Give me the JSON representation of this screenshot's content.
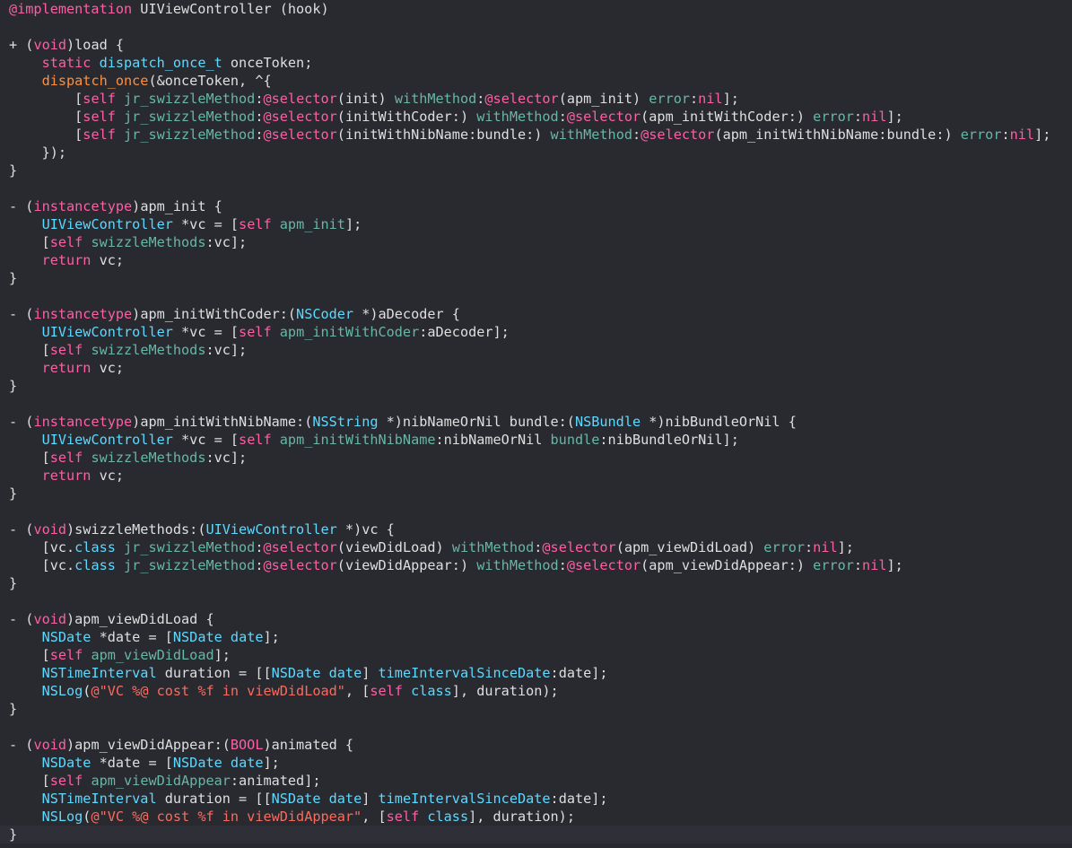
{
  "editor": {
    "theme_colors": {
      "background": "#292a30",
      "plain_text": "#dfdfe0",
      "keyword": "#fc5fa3",
      "system_type": "#5dd8ff",
      "project_method": "#67b7a4",
      "string": "#fc6a5d",
      "macro": "#fd8f3f",
      "current_line": "#2f3037"
    },
    "cursor_line": 47,
    "lines": [
      [
        [
          "@implementation",
          "kw"
        ],
        [
          " UIViewController (hook)",
          "txt"
        ]
      ],
      [],
      [
        [
          "+ (",
          "txt"
        ],
        [
          "void",
          "kb"
        ],
        [
          ")load {",
          "txt"
        ]
      ],
      [
        [
          "    ",
          "txt"
        ],
        [
          "static",
          "kw"
        ],
        [
          " ",
          "txt"
        ],
        [
          "dispatch_once_t",
          "sys"
        ],
        [
          " onceToken;",
          "txt"
        ]
      ],
      [
        [
          "    ",
          "txt"
        ],
        [
          "dispatch_once",
          "mac"
        ],
        [
          "(&onceToken, ^{",
          "txt"
        ]
      ],
      [
        [
          "        [",
          "txt"
        ],
        [
          "self",
          "kw"
        ],
        [
          " ",
          "txt"
        ],
        [
          "jr_swizzleMethod",
          "pm"
        ],
        [
          ":",
          "txt"
        ],
        [
          "@selector",
          "sel"
        ],
        [
          "(init) ",
          "txt"
        ],
        [
          "withMethod",
          "pm"
        ],
        [
          ":",
          "txt"
        ],
        [
          "@selector",
          "sel"
        ],
        [
          "(apm_init) ",
          "txt"
        ],
        [
          "error",
          "pm"
        ],
        [
          ":",
          "txt"
        ],
        [
          "nil",
          "kb"
        ],
        [
          "];",
          "txt"
        ]
      ],
      [
        [
          "        [",
          "txt"
        ],
        [
          "self",
          "kw"
        ],
        [
          " ",
          "txt"
        ],
        [
          "jr_swizzleMethod",
          "pm"
        ],
        [
          ":",
          "txt"
        ],
        [
          "@selector",
          "sel"
        ],
        [
          "(initWithCoder:) ",
          "txt"
        ],
        [
          "withMethod",
          "pm"
        ],
        [
          ":",
          "txt"
        ],
        [
          "@selector",
          "sel"
        ],
        [
          "(apm_initWithCoder:) ",
          "txt"
        ],
        [
          "error",
          "pm"
        ],
        [
          ":",
          "txt"
        ],
        [
          "nil",
          "kb"
        ],
        [
          "];",
          "txt"
        ]
      ],
      [
        [
          "        [",
          "txt"
        ],
        [
          "self",
          "kw"
        ],
        [
          " ",
          "txt"
        ],
        [
          "jr_swizzleMethod",
          "pm"
        ],
        [
          ":",
          "txt"
        ],
        [
          "@selector",
          "sel"
        ],
        [
          "(initWithNibName:bundle:) ",
          "txt"
        ],
        [
          "withMethod",
          "pm"
        ],
        [
          ":",
          "txt"
        ],
        [
          "@selector",
          "sel"
        ],
        [
          "(apm_initWithNibName:bundle:) ",
          "txt"
        ],
        [
          "error",
          "pm"
        ],
        [
          ":",
          "txt"
        ],
        [
          "nil",
          "kb"
        ],
        [
          "];",
          "txt"
        ]
      ],
      [
        [
          "    });",
          "txt"
        ]
      ],
      [
        [
          "}",
          "txt"
        ]
      ],
      [],
      [
        [
          "- (",
          "txt"
        ],
        [
          "instancetype",
          "kb"
        ],
        [
          ")apm_init {",
          "txt"
        ]
      ],
      [
        [
          "    ",
          "txt"
        ],
        [
          "UIViewController",
          "sys"
        ],
        [
          " *vc = [",
          "txt"
        ],
        [
          "self",
          "kw"
        ],
        [
          " ",
          "txt"
        ],
        [
          "apm_init",
          "pm"
        ],
        [
          "];",
          "txt"
        ]
      ],
      [
        [
          "    [",
          "txt"
        ],
        [
          "self",
          "kw"
        ],
        [
          " ",
          "txt"
        ],
        [
          "swizzleMethods",
          "pm"
        ],
        [
          ":vc];",
          "txt"
        ]
      ],
      [
        [
          "    ",
          "txt"
        ],
        [
          "return",
          "kw"
        ],
        [
          " vc;",
          "txt"
        ]
      ],
      [
        [
          "}",
          "txt"
        ]
      ],
      [],
      [
        [
          "- (",
          "txt"
        ],
        [
          "instancetype",
          "kb"
        ],
        [
          ")apm_initWithCoder:(",
          "txt"
        ],
        [
          "NSCoder",
          "sys"
        ],
        [
          " *)aDecoder {",
          "txt"
        ]
      ],
      [
        [
          "    ",
          "txt"
        ],
        [
          "UIViewController",
          "sys"
        ],
        [
          " *vc = [",
          "txt"
        ],
        [
          "self",
          "kw"
        ],
        [
          " ",
          "txt"
        ],
        [
          "apm_initWithCoder",
          "pm"
        ],
        [
          ":aDecoder];",
          "txt"
        ]
      ],
      [
        [
          "    [",
          "txt"
        ],
        [
          "self",
          "kw"
        ],
        [
          " ",
          "txt"
        ],
        [
          "swizzleMethods",
          "pm"
        ],
        [
          ":vc];",
          "txt"
        ]
      ],
      [
        [
          "    ",
          "txt"
        ],
        [
          "return",
          "kw"
        ],
        [
          " vc;",
          "txt"
        ]
      ],
      [
        [
          "}",
          "txt"
        ]
      ],
      [],
      [
        [
          "- (",
          "txt"
        ],
        [
          "instancetype",
          "kb"
        ],
        [
          ")apm_initWithNibName:(",
          "txt"
        ],
        [
          "NSString",
          "sys"
        ],
        [
          " *)nibNameOrNil bundle:(",
          "txt"
        ],
        [
          "NSBundle",
          "sys"
        ],
        [
          " *)nibBundleOrNil {",
          "txt"
        ]
      ],
      [
        [
          "    ",
          "txt"
        ],
        [
          "UIViewController",
          "sys"
        ],
        [
          " *vc = [",
          "txt"
        ],
        [
          "self",
          "kw"
        ],
        [
          " ",
          "txt"
        ],
        [
          "apm_initWithNibName",
          "pm"
        ],
        [
          ":nibNameOrNil ",
          "txt"
        ],
        [
          "bundle",
          "pm"
        ],
        [
          ":nibBundleOrNil];",
          "txt"
        ]
      ],
      [
        [
          "    [",
          "txt"
        ],
        [
          "self",
          "kw"
        ],
        [
          " ",
          "txt"
        ],
        [
          "swizzleMethods",
          "pm"
        ],
        [
          ":vc];",
          "txt"
        ]
      ],
      [
        [
          "    ",
          "txt"
        ],
        [
          "return",
          "kw"
        ],
        [
          " vc;",
          "txt"
        ]
      ],
      [
        [
          "}",
          "txt"
        ]
      ],
      [],
      [
        [
          "- (",
          "txt"
        ],
        [
          "void",
          "kb"
        ],
        [
          ")swizzleMethods:(",
          "txt"
        ],
        [
          "UIViewController",
          "sys"
        ],
        [
          " *)vc {",
          "txt"
        ]
      ],
      [
        [
          "    [vc.",
          "txt"
        ],
        [
          "class",
          "sys"
        ],
        [
          " ",
          "txt"
        ],
        [
          "jr_swizzleMethod",
          "pm"
        ],
        [
          ":",
          "txt"
        ],
        [
          "@selector",
          "sel"
        ],
        [
          "(viewDidLoad) ",
          "txt"
        ],
        [
          "withMethod",
          "pm"
        ],
        [
          ":",
          "txt"
        ],
        [
          "@selector",
          "sel"
        ],
        [
          "(apm_viewDidLoad) ",
          "txt"
        ],
        [
          "error",
          "pm"
        ],
        [
          ":",
          "txt"
        ],
        [
          "nil",
          "kb"
        ],
        [
          "];",
          "txt"
        ]
      ],
      [
        [
          "    [vc.",
          "txt"
        ],
        [
          "class",
          "sys"
        ],
        [
          " ",
          "txt"
        ],
        [
          "jr_swizzleMethod",
          "pm"
        ],
        [
          ":",
          "txt"
        ],
        [
          "@selector",
          "sel"
        ],
        [
          "(viewDidAppear:) ",
          "txt"
        ],
        [
          "withMethod",
          "pm"
        ],
        [
          ":",
          "txt"
        ],
        [
          "@selector",
          "sel"
        ],
        [
          "(apm_viewDidAppear:) ",
          "txt"
        ],
        [
          "error",
          "pm"
        ],
        [
          ":",
          "txt"
        ],
        [
          "nil",
          "kb"
        ],
        [
          "];",
          "txt"
        ]
      ],
      [
        [
          "}",
          "txt"
        ]
      ],
      [],
      [
        [
          "- (",
          "txt"
        ],
        [
          "void",
          "kb"
        ],
        [
          ")apm_viewDidLoad {",
          "txt"
        ]
      ],
      [
        [
          "    ",
          "txt"
        ],
        [
          "NSDate",
          "sys"
        ],
        [
          " *date = [",
          "txt"
        ],
        [
          "NSDate",
          "sys"
        ],
        [
          " ",
          "txt"
        ],
        [
          "date",
          "sys"
        ],
        [
          "];",
          "txt"
        ]
      ],
      [
        [
          "    [",
          "txt"
        ],
        [
          "self",
          "kw"
        ],
        [
          " ",
          "txt"
        ],
        [
          "apm_viewDidLoad",
          "pm"
        ],
        [
          "];",
          "txt"
        ]
      ],
      [
        [
          "    ",
          "txt"
        ],
        [
          "NSTimeInterval",
          "sys"
        ],
        [
          " duration = [[",
          "txt"
        ],
        [
          "NSDate",
          "sys"
        ],
        [
          " ",
          "txt"
        ],
        [
          "date",
          "sys"
        ],
        [
          "] ",
          "txt"
        ],
        [
          "timeIntervalSinceDate",
          "sys"
        ],
        [
          ":date];",
          "txt"
        ]
      ],
      [
        [
          "    ",
          "txt"
        ],
        [
          "NSLog",
          "sys"
        ],
        [
          "(",
          "txt"
        ],
        [
          "@\"VC %@ cost %f in viewDidLoad\"",
          "str"
        ],
        [
          ", [",
          "txt"
        ],
        [
          "self",
          "kw"
        ],
        [
          " ",
          "txt"
        ],
        [
          "class",
          "sys"
        ],
        [
          "], duration);",
          "txt"
        ]
      ],
      [
        [
          "}",
          "txt"
        ]
      ],
      [],
      [
        [
          "- (",
          "txt"
        ],
        [
          "void",
          "kb"
        ],
        [
          ")apm_viewDidAppear:(",
          "txt"
        ],
        [
          "BOOL",
          "kb"
        ],
        [
          ")animated {",
          "txt"
        ]
      ],
      [
        [
          "    ",
          "txt"
        ],
        [
          "NSDate",
          "sys"
        ],
        [
          " *date = [",
          "txt"
        ],
        [
          "NSDate",
          "sys"
        ],
        [
          " ",
          "txt"
        ],
        [
          "date",
          "sys"
        ],
        [
          "];",
          "txt"
        ]
      ],
      [
        [
          "    [",
          "txt"
        ],
        [
          "self",
          "kw"
        ],
        [
          " ",
          "txt"
        ],
        [
          "apm_viewDidAppear",
          "pm"
        ],
        [
          ":animated];",
          "txt"
        ]
      ],
      [
        [
          "    ",
          "txt"
        ],
        [
          "NSTimeInterval",
          "sys"
        ],
        [
          " duration = [[",
          "txt"
        ],
        [
          "NSDate",
          "sys"
        ],
        [
          " ",
          "txt"
        ],
        [
          "date",
          "sys"
        ],
        [
          "] ",
          "txt"
        ],
        [
          "timeIntervalSinceDate",
          "sys"
        ],
        [
          ":date];",
          "txt"
        ]
      ],
      [
        [
          "    ",
          "txt"
        ],
        [
          "NSLog",
          "sys"
        ],
        [
          "(",
          "txt"
        ],
        [
          "@\"VC %@ cost %f in viewDidAppear\"",
          "str"
        ],
        [
          ", [",
          "txt"
        ],
        [
          "self",
          "kw"
        ],
        [
          " ",
          "txt"
        ],
        [
          "class",
          "sys"
        ],
        [
          "], duration);",
          "txt"
        ]
      ],
      [
        [
          "}",
          "txt"
        ]
      ]
    ]
  }
}
